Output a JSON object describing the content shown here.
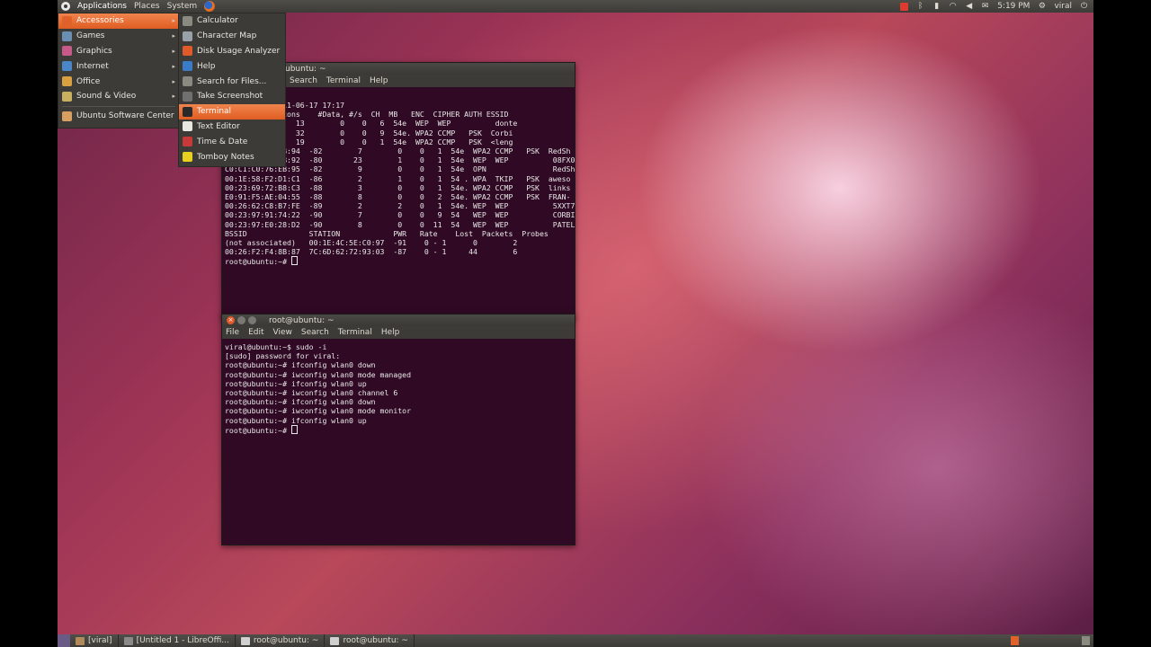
{
  "top_panel": {
    "menus": [
      "Applications",
      "Places",
      "System"
    ],
    "clock": "5:19 PM",
    "user": "viral",
    "tray_icons": [
      "red-indicator-icon",
      "bluetooth-icon",
      "battery-icon",
      "wifi-icon",
      "volume-icon",
      "mail-icon",
      "power-icon"
    ]
  },
  "applications_menu": {
    "items": [
      {
        "label": "Accessories",
        "icon": "accessories-icon",
        "color": "#e0622a",
        "active": true
      },
      {
        "label": "Games",
        "icon": "games-icon",
        "color": "#6a8fb3"
      },
      {
        "label": "Graphics",
        "icon": "graphics-icon",
        "color": "#c85a8a"
      },
      {
        "label": "Internet",
        "icon": "internet-icon",
        "color": "#4a86c8"
      },
      {
        "label": "Office",
        "icon": "office-icon",
        "color": "#d8a040"
      },
      {
        "label": "Sound & Video",
        "icon": "sound-video-icon",
        "color": "#c8b060"
      }
    ],
    "software_center": "Ubuntu Software Center"
  },
  "accessories_submenu": {
    "items": [
      {
        "label": "Calculator",
        "icon": "calculator-icon",
        "color": "#8a8a80"
      },
      {
        "label": "Character Map",
        "icon": "character-map-icon",
        "color": "#9aa0a8"
      },
      {
        "label": "Disk Usage Analyzer",
        "icon": "disk-usage-icon",
        "color": "#e05a2a"
      },
      {
        "label": "Help",
        "icon": "help-icon",
        "color": "#3a7cc8"
      },
      {
        "label": "Search for Files...",
        "icon": "search-files-icon",
        "color": "#8a8a80"
      },
      {
        "label": "Take Screenshot",
        "icon": "screenshot-icon",
        "color": "#707070"
      },
      {
        "label": "Terminal",
        "icon": "terminal-icon",
        "color": "#2a2a2a",
        "active": true
      },
      {
        "label": "Text Editor",
        "icon": "text-editor-icon",
        "color": "#e8e8e0"
      },
      {
        "label": "Time & Date",
        "icon": "time-date-icon",
        "color": "#c83a3a"
      },
      {
        "label": "Tomboy Notes",
        "icon": "tomboy-notes-icon",
        "color": "#e8d020"
      }
    ]
  },
  "terminal1": {
    "title": "ubuntu: ~",
    "menu": [
      "Search",
      "Terminal",
      "Help"
    ],
    "lines": [
      "ed: 8 s ][ 2011-06-17 17:17",
      "",
      "     PWR  Beacons    #Data, #/s  CH  MB   ENC  CIPHER AUTH ESSID",
      "",
      "):BC  -54       13        0    0   6  54e  WEP  WEP          donte",
      "):87  -80       32        0    0   9  54e. WPA2 CCMP   PSK  Corbi",
      "):93  -82       19        0    0   1  54e  WPA2 CCMP   PSK  <leng",
      "C0:C1:C0:76:EB:94  -82        7        0    0   1  54e  WPA2 CCMP   PSK  RedSh",
      "00:18:3A:B9:3B:92  -80       23        1    0   1  54e  WEP  WEP          08FX0",
      "C0:C1:C0:76:EB:95  -82        9        0    0   1  54e  OPN               RedSh",
      "00:1E:58:F2:D1:C1  -86        2        1    0   1  54 . WPA  TKIP   PSK  aweso",
      "00:23:69:72:B8:C3  -88        3        0    0   1  54e. WPA2 CCMP   PSK  links",
      "E0:91:F5:AE:04:55  -88        8        0    0   2  54e. WPA2 CCMP   PSK  FRAN-",
      "00:26:62:C8:B7:FE  -89        2        2    0   1  54e. WEP  WEP          5XXT7",
      "00:23:97:91:74:22  -90        7        0    0   9  54   WEP  WEP          CORBI",
      "00:23:97:E0:28:D2  -90        8        0    0  11  54   WEP  WEP          PATEL",
      "",
      "BSSID              STATION            PWR   Rate    Lost  Packets  Probes",
      "",
      "(not associated)   00:1E:4C:5E:C0:97  -91    0 - 1      0        2",
      "00:26:F2:F4:8B:87  7C:6D:62:72:93:03  -87    0 - 1     44        6",
      "",
      "root@ubuntu:~# "
    ]
  },
  "terminal2": {
    "title": "root@ubuntu: ~",
    "menu": [
      "File",
      "Edit",
      "View",
      "Search",
      "Terminal",
      "Help"
    ],
    "lines": [
      "viral@ubuntu:~$ sudo -i",
      "[sudo] password for viral:",
      "root@ubuntu:~# ifconfig wlan0 down",
      "root@ubuntu:~# iwconfig wlan0 mode managed",
      "root@ubuntu:~# ifconfig wlan0 up",
      "root@ubuntu:~# iwconfig wlan0 channel 6",
      "root@ubuntu:~# ifconfig wlan0 down",
      "root@ubuntu:~# iwconfig wlan0 mode monitor",
      "root@ubuntu:~# ifconfig wlan0 up",
      "root@ubuntu:~# "
    ]
  },
  "taskbar": {
    "items": [
      {
        "label": "[viral]",
        "icon": "folder-icon",
        "color": "#b08a5a"
      },
      {
        "label": "[Untitled 1 - LibreOffi...",
        "icon": "libreoffice-icon",
        "color": "#8a8a8a"
      },
      {
        "label": "root@ubuntu: ~",
        "icon": "terminal-icon",
        "color": "#d0d0d0"
      },
      {
        "label": "root@ubuntu: ~",
        "icon": "terminal-icon",
        "color": "#d0d0d0"
      }
    ]
  }
}
